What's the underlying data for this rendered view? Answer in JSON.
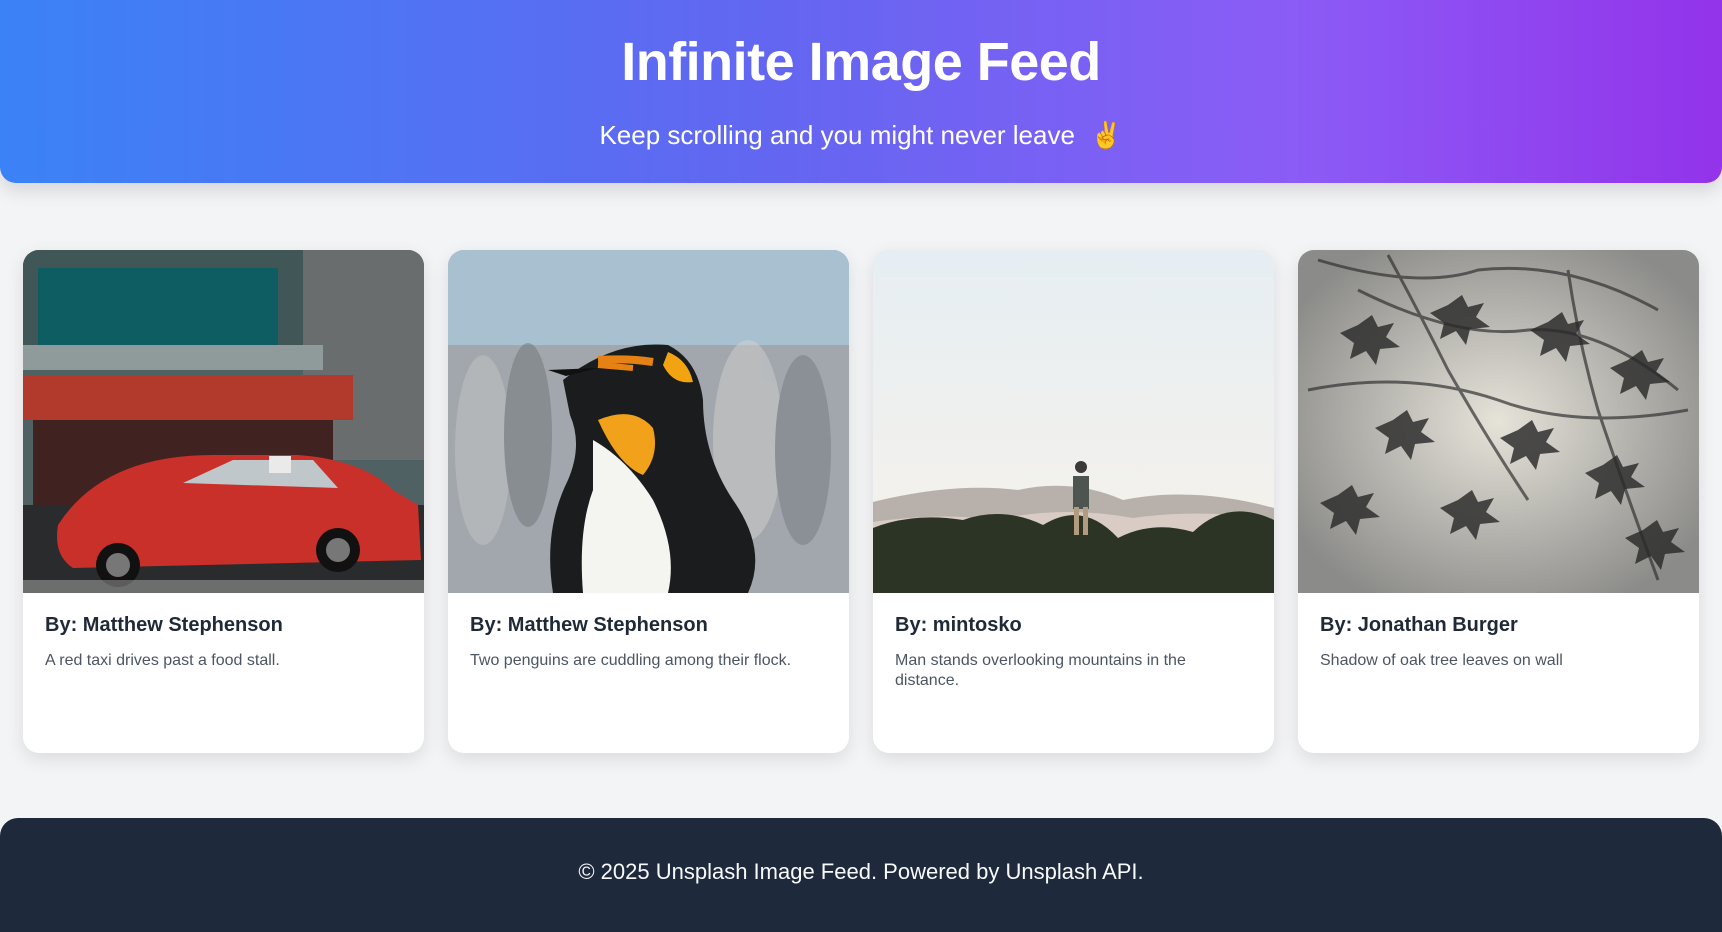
{
  "header": {
    "title": "Infinite Image Feed",
    "subtitle": "Keep scrolling and you might never leave",
    "emoji": "✌️"
  },
  "cards": [
    {
      "author": "By: Matthew Stephenson",
      "description": "A red taxi drives past a food stall.",
      "image_alt": "A red taxi drives past a food stall."
    },
    {
      "author": "By: Matthew Stephenson",
      "description": "Two penguins are cuddling among their flock.",
      "image_alt": "Two penguins are cuddling among their flock."
    },
    {
      "author": "By: mintosko",
      "description": "Man stands overlooking mountains in the distance.",
      "image_alt": "Man stands overlooking mountains in the distance."
    },
    {
      "author": "By: Jonathan Burger",
      "description": "Shadow of oak tree leaves on wall",
      "image_alt": "Shadow of oak tree leaves on wall"
    }
  ],
  "footer": {
    "text": "© 2025 Unsplash Image Feed. Powered by Unsplash API."
  },
  "colors": {
    "header_gradient_start": "#3b82f6",
    "header_gradient_end": "#9333ea",
    "page_bg": "#f3f4f6",
    "footer_bg": "#1e293b",
    "card_bg": "#ffffff",
    "author_text": "#1f2937",
    "description_text": "#4b5563"
  }
}
